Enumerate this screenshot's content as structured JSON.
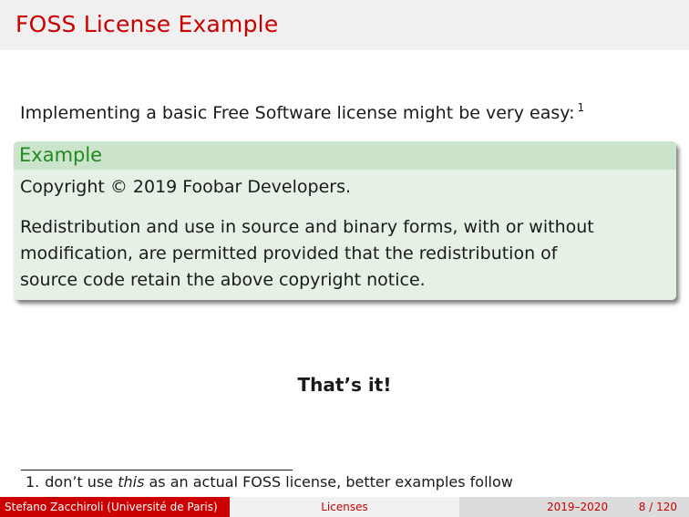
{
  "frame": {
    "title": "FOSS License Example"
  },
  "intro": {
    "text": "Implementing a basic Free Software license might be very easy:",
    "footnote_mark": "1"
  },
  "example_block": {
    "title": "Example",
    "line1": "Copyright © 2019 Foobar Developers.",
    "paragraph_line1": "Redistribution and use in source and binary forms, with or without",
    "paragraph_line2": "modification, are permitted provided that the redistribution of",
    "paragraph_line3": "source code retain the above copyright notice."
  },
  "conclusion": "That’s it!",
  "footnote": {
    "number": "1.",
    "before": "don’t use ",
    "emphasis": "this",
    "after": " as an actual FOSS license, better examples follow"
  },
  "footline": {
    "author": "Stefano Zacchiroli",
    "institute": "(Université de Paris)",
    "short_title": "Licenses",
    "date": "2019–2020",
    "page": "8 / 120"
  },
  "colors": {
    "title_red": "#cc0000",
    "block_head_bg": "#cce3cc",
    "block_body_bg": "#e6f1e6",
    "block_title_green": "#1f8a1f"
  }
}
